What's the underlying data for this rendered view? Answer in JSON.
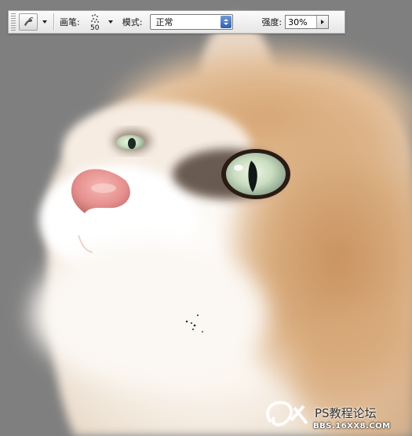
{
  "toolbar": {
    "tool_icon": "smudge-finger-icon",
    "brush_label": "画笔:",
    "brush_size": "50",
    "mode_label": "模式:",
    "mode_value": "正常",
    "strength_label": "强度:",
    "strength_value": "30%"
  },
  "canvas": {
    "subject": "cat-portrait-painting",
    "background_color": "#7f7f7f",
    "fur_colors": [
      "#ffffff",
      "#f3e3d2",
      "#d8a878",
      "#b8845c"
    ],
    "eye_color": "#cfe3c6",
    "nose_color": "#f0a6a4"
  },
  "watermark": {
    "text": "PS教程论坛",
    "url": "BBS.16XX8.COM"
  }
}
